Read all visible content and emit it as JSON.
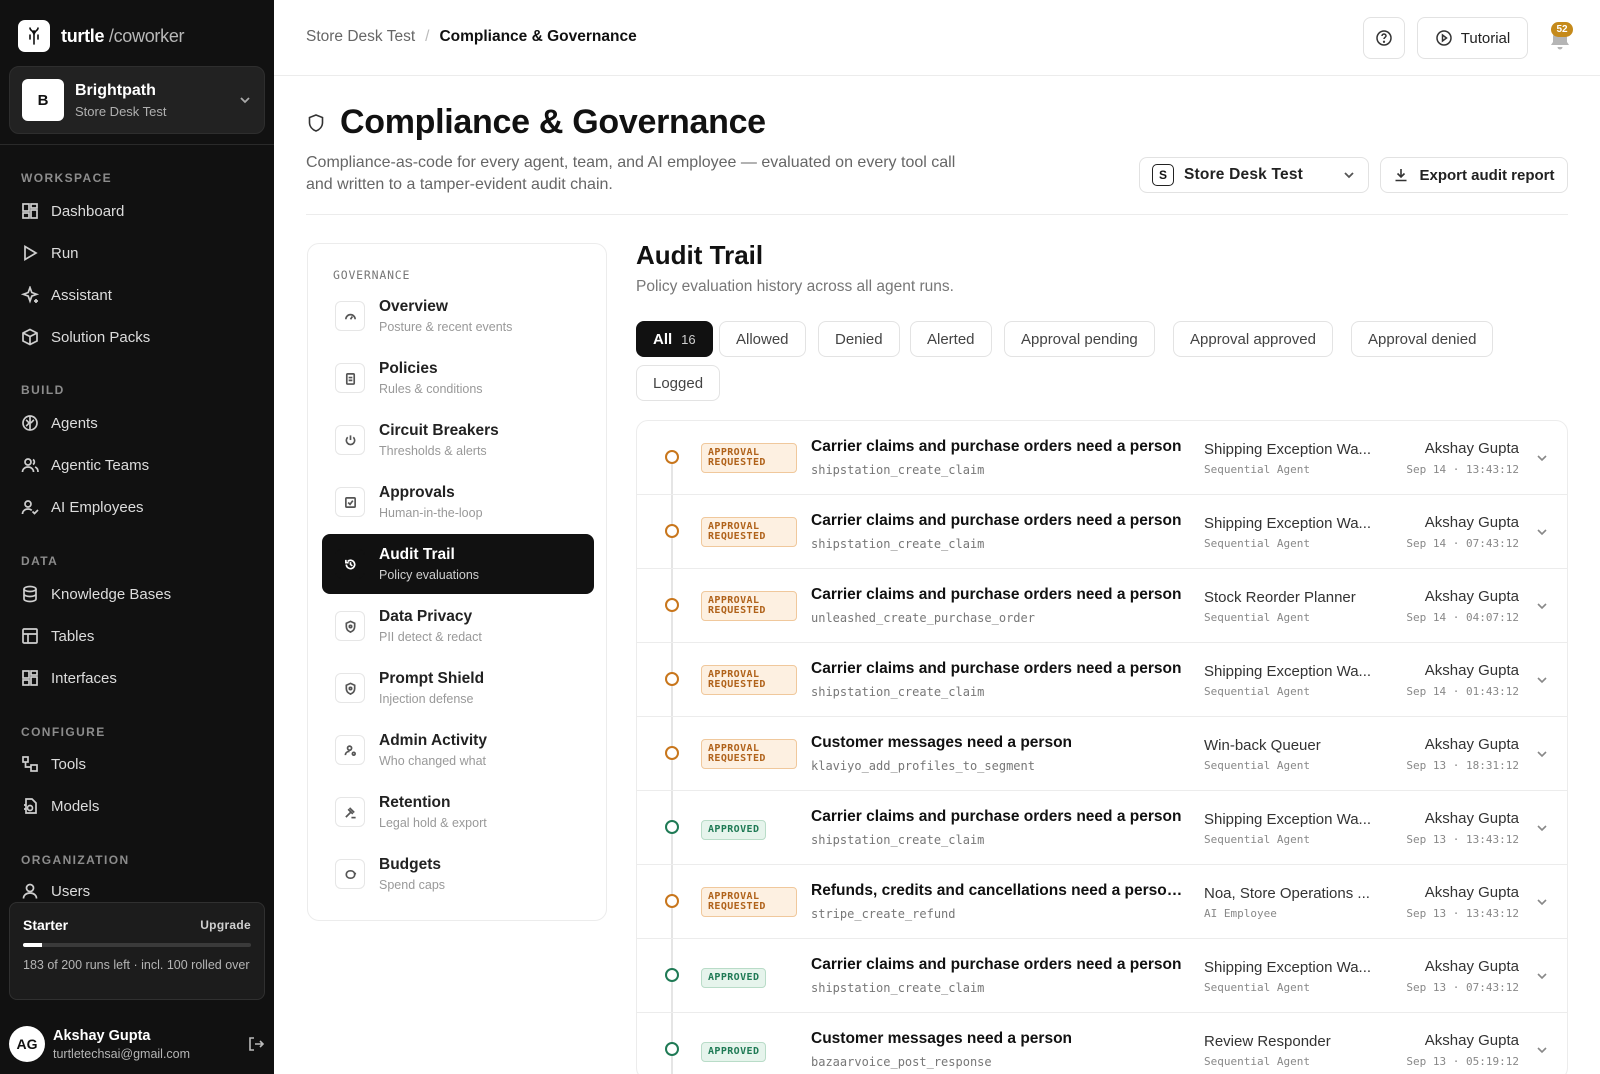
{
  "brand": {
    "name": "turtle",
    "suffix": " /coworker"
  },
  "org": {
    "initial": "B",
    "name": "Brightpath",
    "sub": "Store Desk Test"
  },
  "sidebar": {
    "sections": {
      "workspace": "WORKSPACE",
      "build": "BUILD",
      "data": "DATA",
      "configure": "CONFIGURE",
      "organization": "ORGANIZATION"
    },
    "items": {
      "dashboard": "Dashboard",
      "run": "Run",
      "assistant": "Assistant",
      "solution_packs": "Solution Packs",
      "agents": "Agents",
      "agentic_teams": "Agentic Teams",
      "ai_employees": "AI Employees",
      "knowledge_bases": "Knowledge Bases",
      "tables": "Tables",
      "interfaces": "Interfaces",
      "tools": "Tools",
      "models": "Models",
      "users": "Users"
    },
    "plan": {
      "name": "Starter",
      "upgrade": "Upgrade",
      "usage_fraction": 0.085,
      "note": "183 of 200 runs left · incl. 100 rolled over"
    },
    "user": {
      "initials": "AG",
      "name": "Akshay Gupta",
      "email": "turtletechsai@gmail.com"
    }
  },
  "topbar": {
    "breadcrumb": {
      "parent": "Store Desk Test",
      "separator": "/",
      "current": "Compliance & Governance"
    },
    "tutorial": "Tutorial",
    "notifications": "52"
  },
  "page": {
    "title": "Compliance & Governance",
    "description": "Compliance-as-code for every agent, team, and AI employee — evaluated on every tool call and written to a tamper-evident audit chain.",
    "store_badge": "S",
    "store_select": "Store Desk Test",
    "export": "Export audit report"
  },
  "governance": {
    "title": "GOVERNANCE",
    "items": [
      {
        "label": "Overview",
        "sub": "Posture & recent events"
      },
      {
        "label": "Policies",
        "sub": "Rules & conditions"
      },
      {
        "label": "Circuit Breakers",
        "sub": "Thresholds & alerts"
      },
      {
        "label": "Approvals",
        "sub": "Human-in-the-loop"
      },
      {
        "label": "Audit Trail",
        "sub": "Policy evaluations"
      },
      {
        "label": "Data Privacy",
        "sub": "PII detect & redact"
      },
      {
        "label": "Prompt Shield",
        "sub": "Injection defense"
      },
      {
        "label": "Admin Activity",
        "sub": "Who changed what"
      },
      {
        "label": "Retention",
        "sub": "Legal hold & export"
      },
      {
        "label": "Budgets",
        "sub": "Spend caps"
      }
    ]
  },
  "audit": {
    "title": "Audit Trail",
    "subtitle": "Policy evaluation history across all agent runs.",
    "filters": {
      "all": "All",
      "all_count": "16",
      "allowed": "Allowed",
      "denied": "Denied",
      "alerted": "Alerted",
      "approval_pending": "Approval pending",
      "approval_approved": "Approval approved",
      "approval_denied": "Approval denied",
      "logged": "Logged"
    },
    "rows": [
      {
        "status": "APPROVAL\nREQUESTED",
        "title": "Carrier claims and purchase orders need a person",
        "tool": "shipstation_create_claim",
        "agent": "Shipping Exception Wa...",
        "kind": "Sequential Agent",
        "user": "Akshay Gupta",
        "time": "Sep 14 · 13:43:12"
      },
      {
        "status": "APPROVAL\nREQUESTED",
        "title": "Carrier claims and purchase orders need a person",
        "tool": "shipstation_create_claim",
        "agent": "Shipping Exception Wa...",
        "kind": "Sequential Agent",
        "user": "Akshay Gupta",
        "time": "Sep 14 · 07:43:12"
      },
      {
        "status": "APPROVAL\nREQUESTED",
        "title": "Carrier claims and purchase orders need a person",
        "tool": "unleashed_create_purchase_order",
        "agent": "Stock Reorder Planner",
        "kind": "Sequential Agent",
        "user": "Akshay Gupta",
        "time": "Sep 14 · 04:07:12"
      },
      {
        "status": "APPROVAL\nREQUESTED",
        "title": "Carrier claims and purchase orders need a person",
        "tool": "shipstation_create_claim",
        "agent": "Shipping Exception Wa...",
        "kind": "Sequential Agent",
        "user": "Akshay Gupta",
        "time": "Sep 14 · 01:43:12"
      },
      {
        "status": "APPROVAL\nREQUESTED",
        "title": "Customer messages need a person",
        "tool": "klaviyo_add_profiles_to_segment",
        "agent": "Win-back Queuer",
        "kind": "Sequential Agent",
        "user": "Akshay Gupta",
        "time": "Sep 13 · 18:31:12"
      },
      {
        "status": "APPROVED",
        "title": "Carrier claims and purchase orders need a person",
        "tool": "shipstation_create_claim",
        "agent": "Shipping Exception Wa...",
        "kind": "Sequential Agent",
        "user": "Akshay Gupta",
        "time": "Sep 13 · 13:43:12"
      },
      {
        "status": "APPROVAL\nREQUESTED",
        "title": "Refunds, credits and cancellations need a person i...",
        "tool": "stripe_create_refund",
        "agent": "Noa, Store Operations ...",
        "kind": "AI Employee",
        "user": "Akshay Gupta",
        "time": "Sep 13 · 13:43:12"
      },
      {
        "status": "APPROVED",
        "title": "Carrier claims and purchase orders need a person",
        "tool": "shipstation_create_claim",
        "agent": "Shipping Exception Wa...",
        "kind": "Sequential Agent",
        "user": "Akshay Gupta",
        "time": "Sep 13 · 07:43:12"
      },
      {
        "status": "APPROVED",
        "title": "Customer messages need a person",
        "tool": "bazaarvoice_post_response",
        "agent": "Review Responder",
        "kind": "Sequential Agent",
        "user": "Akshay Gupta",
        "time": "Sep 13 · 05:19:12"
      }
    ]
  },
  "colors": {
    "sidebar_bg": "#111111",
    "accent_dark": "#111111",
    "requested": "#c8761c",
    "approved": "#1f7a55",
    "notification": "#c58a1b"
  }
}
